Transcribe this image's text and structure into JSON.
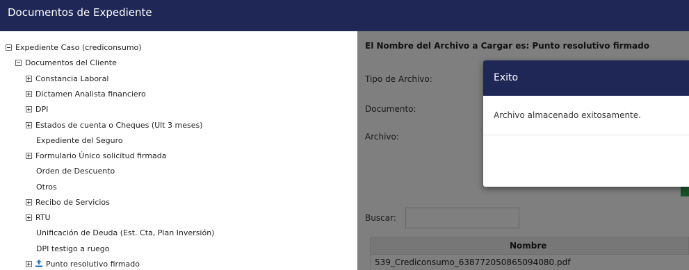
{
  "header": {
    "title": "Documentos de Expediente"
  },
  "tree": {
    "root": "Expediente Caso (crediconsumo)",
    "group": "Documentos del Cliente",
    "items": [
      {
        "label": "Constancia Laboral",
        "expandable": true
      },
      {
        "label": "Dictamen Analista financiero",
        "expandable": true
      },
      {
        "label": "DPI",
        "expandable": true
      },
      {
        "label": "Estados de cuenta o Cheques (Ult 3 meses)",
        "expandable": true
      },
      {
        "label": "Expediente del Seguro",
        "expandable": false
      },
      {
        "label": "Formulario Único solicitud firmada",
        "expandable": true
      },
      {
        "label": "Orden de Descuento",
        "expandable": false
      },
      {
        "label": "Otros",
        "expandable": false
      },
      {
        "label": "Recibo de Servicios",
        "expandable": true
      },
      {
        "label": "RTU",
        "expandable": true
      },
      {
        "label": "Unificación de Deuda (Est. Cta, Plan Inversión)",
        "expandable": false
      },
      {
        "label": "DPI testigo a ruego",
        "expandable": false
      },
      {
        "label": "Punto resolutivo firmado",
        "expandable": true,
        "icon": "upload-icon"
      }
    ]
  },
  "panel": {
    "file_name_label": "El Nombre del Archivo a Cargar es: Punto resolutivo firmado",
    "tipo_label": "Tipo de Archivo:",
    "documento_label": "Documento:",
    "archivo_label": "Archivo:",
    "buscar_label": "Buscar:",
    "search_value": "",
    "table": {
      "header": "Nombre",
      "rows": [
        "539_Crediconsumo_638772050865094080.pdf"
      ]
    }
  },
  "modal": {
    "title": "Exito",
    "message": "Archivo almacenado exitosamente."
  },
  "colors": {
    "header_bg": "#1f2757",
    "modal_head_bg": "#1f2757",
    "overlay": "rgba(0,0,0,0.5)",
    "accent_green": "#2fa84f"
  }
}
